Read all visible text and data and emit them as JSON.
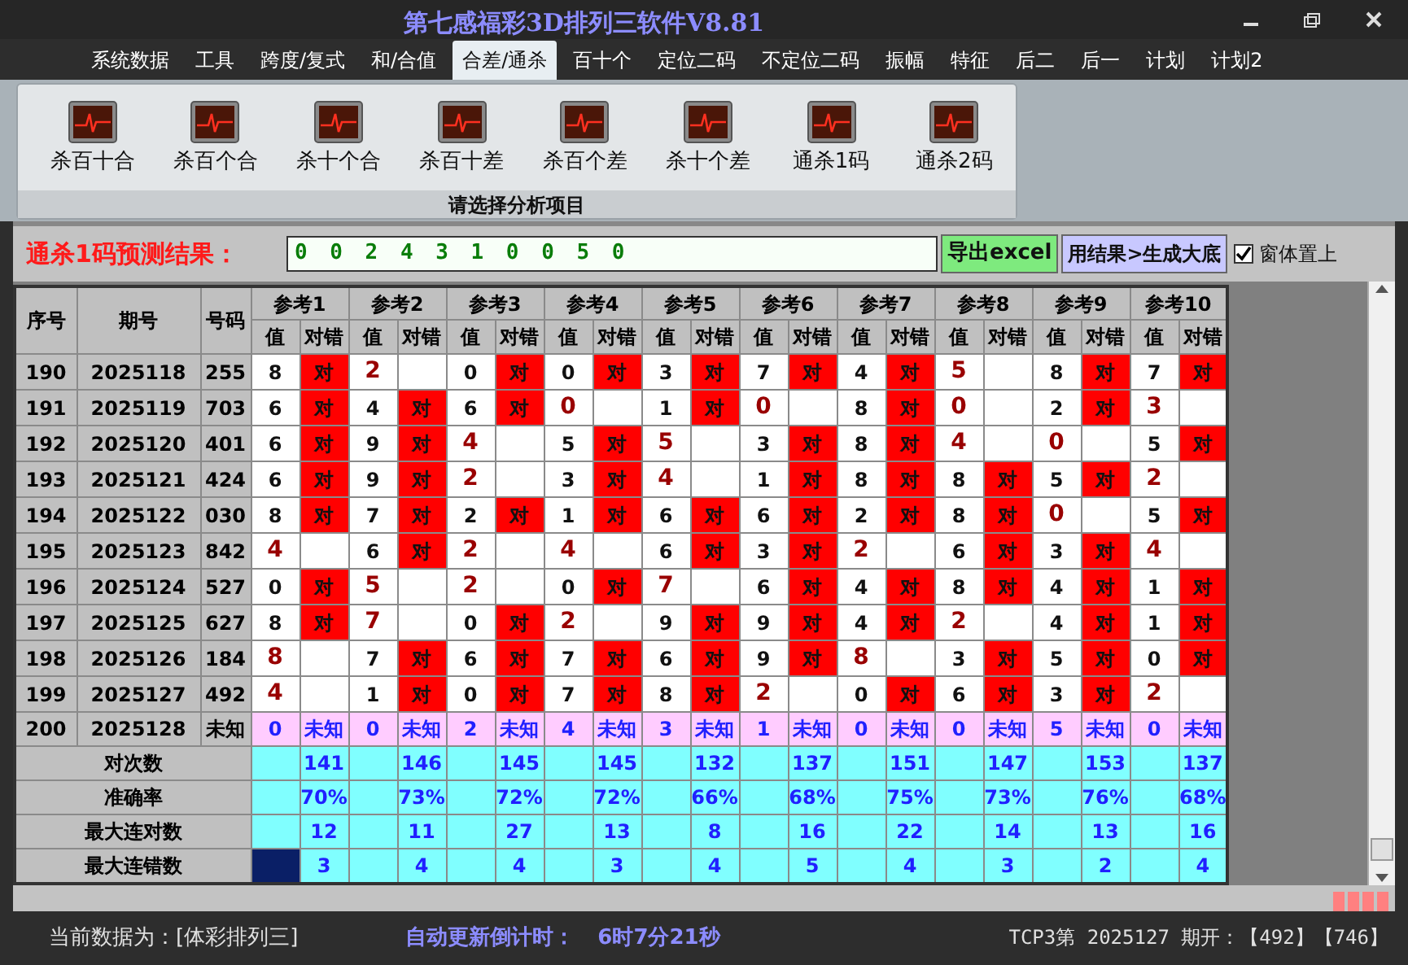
{
  "window": {
    "title": "第七感福彩3D排列三软件V8.81"
  },
  "menu_tabs": [
    {
      "label": "系统数据",
      "selected": false
    },
    {
      "label": "工具",
      "selected": false
    },
    {
      "label": "跨度/复式",
      "selected": false
    },
    {
      "label": "和/合值",
      "selected": false
    },
    {
      "label": "合差/通杀",
      "selected": true
    },
    {
      "label": "百十个",
      "selected": false
    },
    {
      "label": "定位二码",
      "selected": false
    },
    {
      "label": "不定位二码",
      "selected": false
    },
    {
      "label": "振幅",
      "selected": false
    },
    {
      "label": "特征",
      "selected": false
    },
    {
      "label": "后二",
      "selected": false
    },
    {
      "label": "后一",
      "selected": false
    },
    {
      "label": "计划",
      "selected": false
    },
    {
      "label": "计划2",
      "selected": false
    }
  ],
  "ribbon": {
    "items": [
      {
        "label": "杀百十合"
      },
      {
        "label": "杀百个合"
      },
      {
        "label": "杀十个合"
      },
      {
        "label": "杀百十差"
      },
      {
        "label": "杀百个差"
      },
      {
        "label": "杀十个差"
      },
      {
        "label": "通杀1码"
      },
      {
        "label": "通杀2码"
      }
    ],
    "group_label": "请选择分析项目"
  },
  "prediction": {
    "label": "通杀1码预测结果：",
    "value": "0 0 2 4 3 1 0 0 5 0",
    "export_button": "导出excel",
    "generate_button": "用结果>生成大底",
    "topmost": {
      "label": "窗体置上",
      "checked": true
    }
  },
  "table": {
    "columns": [
      "序号",
      "期号",
      "号码"
    ],
    "groups": [
      {
        "label": "参考1",
        "sub_headers": [
          "值",
          "对错"
        ]
      },
      {
        "label": "参考2",
        "sub_headers": [
          "值",
          "对错"
        ]
      },
      {
        "label": "参考3",
        "sub_headers": [
          "值",
          "对错"
        ]
      },
      {
        "label": "参考4",
        "sub_headers": [
          "值",
          "对错"
        ]
      },
      {
        "label": "参考5",
        "sub_headers": [
          "值",
          "对错"
        ]
      },
      {
        "label": "参考6",
        "sub_headers": [
          "值",
          "对错"
        ]
      },
      {
        "label": "参考7",
        "sub_headers": [
          "值",
          "对错"
        ]
      },
      {
        "label": "参考8",
        "sub_headers": [
          "值",
          "对错"
        ]
      },
      {
        "label": "参考9",
        "sub_headers": [
          "值",
          "对错"
        ]
      },
      {
        "label": "参考10",
        "sub_headers": [
          "值",
          "对错"
        ]
      }
    ],
    "rows": [
      {
        "kind": "history",
        "index": "190",
        "issue": "2025118",
        "number": "255",
        "cells": [
          {
            "value": "8",
            "result": "对"
          },
          {
            "value": "2"
          },
          {
            "value": "0",
            "result": "对"
          },
          {
            "value": "0",
            "result": "对"
          },
          {
            "value": "3",
            "result": "对"
          },
          {
            "value": "7",
            "result": "对"
          },
          {
            "value": "4",
            "result": "对"
          },
          {
            "value": "5"
          },
          {
            "value": "8",
            "result": "对"
          },
          {
            "value": "7",
            "result": "对"
          }
        ]
      },
      {
        "kind": "history",
        "index": "191",
        "issue": "2025119",
        "number": "703",
        "cells": [
          {
            "value": "6",
            "result": "对"
          },
          {
            "value": "4",
            "result": "对"
          },
          {
            "value": "6",
            "result": "对"
          },
          {
            "value": "0"
          },
          {
            "value": "1",
            "result": "对"
          },
          {
            "value": "0"
          },
          {
            "value": "8",
            "result": "对"
          },
          {
            "value": "0"
          },
          {
            "value": "2",
            "result": "对"
          },
          {
            "value": "3"
          }
        ]
      },
      {
        "kind": "history",
        "index": "192",
        "issue": "2025120",
        "number": "401",
        "cells": [
          {
            "value": "6",
            "result": "对"
          },
          {
            "value": "9",
            "result": "对"
          },
          {
            "value": "4"
          },
          {
            "value": "5",
            "result": "对"
          },
          {
            "value": "5"
          },
          {
            "value": "3",
            "result": "对"
          },
          {
            "value": "8",
            "result": "对"
          },
          {
            "value": "4"
          },
          {
            "value": "0"
          },
          {
            "value": "5",
            "result": "对"
          }
        ]
      },
      {
        "kind": "history",
        "index": "193",
        "issue": "2025121",
        "number": "424",
        "cells": [
          {
            "value": "6",
            "result": "对"
          },
          {
            "value": "9",
            "result": "对"
          },
          {
            "value": "2"
          },
          {
            "value": "3",
            "result": "对"
          },
          {
            "value": "4"
          },
          {
            "value": "1",
            "result": "对"
          },
          {
            "value": "8",
            "result": "对"
          },
          {
            "value": "8",
            "result": "对"
          },
          {
            "value": "5",
            "result": "对"
          },
          {
            "value": "2"
          }
        ]
      },
      {
        "kind": "history",
        "index": "194",
        "issue": "2025122",
        "number": "030",
        "cells": [
          {
            "value": "8",
            "result": "对"
          },
          {
            "value": "7",
            "result": "对"
          },
          {
            "value": "2",
            "result": "对"
          },
          {
            "value": "1",
            "result": "对"
          },
          {
            "value": "6",
            "result": "对"
          },
          {
            "value": "6",
            "result": "对"
          },
          {
            "value": "2",
            "result": "对"
          },
          {
            "value": "8",
            "result": "对"
          },
          {
            "value": "0"
          },
          {
            "value": "5",
            "result": "对"
          }
        ]
      },
      {
        "kind": "history",
        "index": "195",
        "issue": "2025123",
        "number": "842",
        "cells": [
          {
            "value": "4"
          },
          {
            "value": "6",
            "result": "对"
          },
          {
            "value": "2"
          },
          {
            "value": "4"
          },
          {
            "value": "6",
            "result": "对"
          },
          {
            "value": "3",
            "result": "对"
          },
          {
            "value": "2"
          },
          {
            "value": "6",
            "result": "对"
          },
          {
            "value": "3",
            "result": "对"
          },
          {
            "value": "4"
          }
        ]
      },
      {
        "kind": "history",
        "index": "196",
        "issue": "2025124",
        "number": "527",
        "cells": [
          {
            "value": "0",
            "result": "对"
          },
          {
            "value": "5"
          },
          {
            "value": "2"
          },
          {
            "value": "0",
            "result": "对"
          },
          {
            "value": "7"
          },
          {
            "value": "6",
            "result": "对"
          },
          {
            "value": "4",
            "result": "对"
          },
          {
            "value": "8",
            "result": "对"
          },
          {
            "value": "4",
            "result": "对"
          },
          {
            "value": "1",
            "result": "对"
          }
        ]
      },
      {
        "kind": "history",
        "index": "197",
        "issue": "2025125",
        "number": "627",
        "cells": [
          {
            "value": "8",
            "result": "对"
          },
          {
            "value": "7"
          },
          {
            "value": "0",
            "result": "对"
          },
          {
            "value": "2"
          },
          {
            "value": "9",
            "result": "对"
          },
          {
            "value": "9",
            "result": "对"
          },
          {
            "value": "4",
            "result": "对"
          },
          {
            "value": "2"
          },
          {
            "value": "4",
            "result": "对"
          },
          {
            "value": "1",
            "result": "对"
          }
        ]
      },
      {
        "kind": "history",
        "index": "198",
        "issue": "2025126",
        "number": "184",
        "cells": [
          {
            "value": "8"
          },
          {
            "value": "7",
            "result": "对"
          },
          {
            "value": "6",
            "result": "对"
          },
          {
            "value": "7",
            "result": "对"
          },
          {
            "value": "6",
            "result": "对"
          },
          {
            "value": "9",
            "result": "对"
          },
          {
            "value": "8"
          },
          {
            "value": "3",
            "result": "对"
          },
          {
            "value": "5",
            "result": "对"
          },
          {
            "value": "0",
            "result": "对"
          }
        ]
      },
      {
        "kind": "history",
        "index": "199",
        "issue": "2025127",
        "number": "492",
        "cells": [
          {
            "value": "4"
          },
          {
            "value": "1",
            "result": "对"
          },
          {
            "value": "0",
            "result": "对"
          },
          {
            "value": "7",
            "result": "对"
          },
          {
            "value": "8",
            "result": "对"
          },
          {
            "value": "2"
          },
          {
            "value": "0",
            "result": "对"
          },
          {
            "value": "6",
            "result": "对"
          },
          {
            "value": "3",
            "result": "对"
          },
          {
            "value": "2"
          }
        ]
      },
      {
        "kind": "pending",
        "index": "200",
        "issue": "2025128",
        "number": "未知",
        "cells": [
          {
            "value": "0",
            "result": "未知"
          },
          {
            "value": "0",
            "result": "未知"
          },
          {
            "value": "2",
            "result": "未知"
          },
          {
            "value": "4",
            "result": "未知"
          },
          {
            "value": "3",
            "result": "未知"
          },
          {
            "value": "1",
            "result": "未知"
          },
          {
            "value": "0",
            "result": "未知"
          },
          {
            "value": "0",
            "result": "未知"
          },
          {
            "value": "5",
            "result": "未知"
          },
          {
            "value": "0",
            "result": "未知"
          }
        ]
      }
    ],
    "stats": [
      {
        "label": "对次数",
        "values": [
          "141",
          "146",
          "145",
          "145",
          "132",
          "137",
          "151",
          "147",
          "153",
          "137"
        ],
        "cursor": false
      },
      {
        "label": "准确率",
        "values": [
          "70%",
          "73%",
          "72%",
          "72%",
          "66%",
          "68%",
          "75%",
          "73%",
          "76%",
          "68%"
        ],
        "cursor": false
      },
      {
        "label": "最大连对数",
        "values": [
          "12",
          "11",
          "27",
          "13",
          "8",
          "16",
          "22",
          "14",
          "13",
          "16"
        ],
        "cursor": false
      },
      {
        "label": "最大连错数",
        "values": [
          "3",
          "4",
          "4",
          "3",
          "4",
          "5",
          "4",
          "3",
          "2",
          "4"
        ],
        "cursor": true
      }
    ]
  },
  "status_bar": {
    "data_source": "当前数据为：[体彩排列三]",
    "countdown_label": "自动更新倒计时：",
    "countdown": "6时7分21秒",
    "latest": "TCP3第 2025127 期开：【492】【746】"
  }
}
